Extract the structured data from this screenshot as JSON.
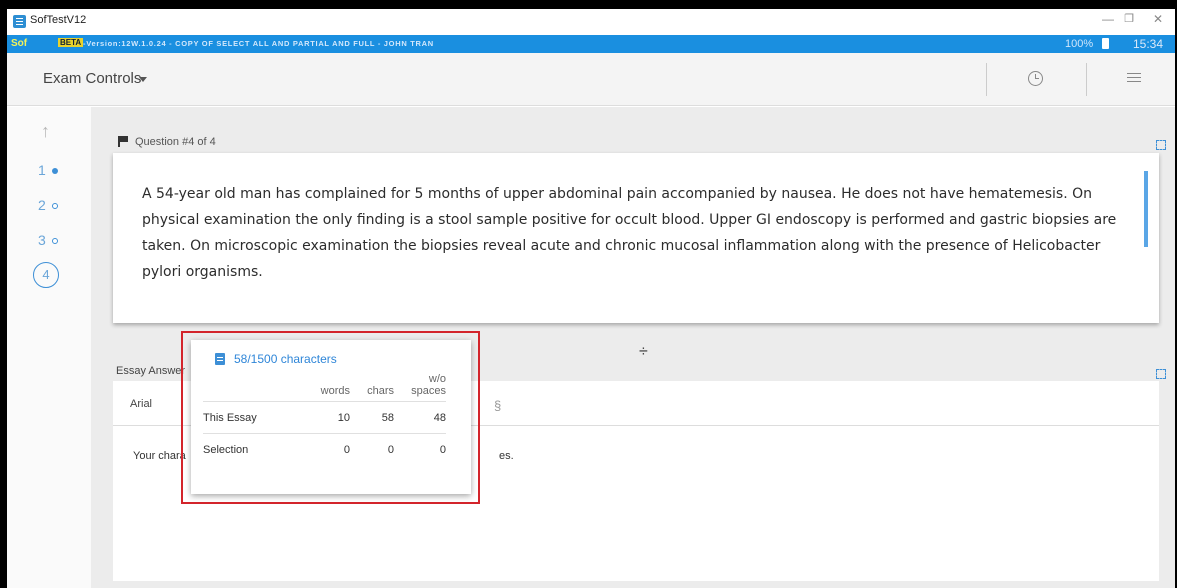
{
  "window": {
    "title": "SofTestV12",
    "minimize": "—",
    "maximize": "❐",
    "close": "✕"
  },
  "banner": {
    "brand": "Sof",
    "beta": "BETA",
    "version": "-Version:12W.1.0.24 - COPY OF SELECT ALL AND PARTIAL AND FULL - JOHN TRAN",
    "battery": "100%",
    "time": "15:34",
    "colors": {
      "banner": "#1a8fe0",
      "beta_badge": "#e8d22c"
    }
  },
  "toolbar": {
    "exam_controls": "Exam Controls",
    "icons": [
      "clock-icon",
      "menu-icon"
    ]
  },
  "nav": {
    "up_arrow": "↑",
    "questions": [
      {
        "label": "1",
        "status": "answered"
      },
      {
        "label": "2",
        "status": "unanswered"
      },
      {
        "label": "3",
        "status": "unanswered"
      }
    ],
    "current": "4"
  },
  "question": {
    "header": "Question #4 of 4",
    "text": "A 54-year old man has complained for 5 months of upper abdominal pain accompanied by nausea. He does not have hematemesis. On physical examination the only finding is a stool sample positive for occult blood. Upper GI endoscopy is performed and gastric biopsies are taken. On microscopic examination the biopsies reveal acute and chronic mucosal inflammation along with the presence of Helicobacter pylori organisms."
  },
  "essay": {
    "header": "Essay Answer",
    "font": "Arial",
    "section_symbol": "§",
    "text_start": "Your chara",
    "text_end": "es."
  },
  "popover": {
    "title": "58/1500 characters",
    "headers": {
      "words": "words",
      "chars": "chars",
      "spaces_1": "w/o",
      "spaces_2": "spaces"
    },
    "rows": [
      {
        "label": "This Essay",
        "words": "10",
        "chars": "58",
        "spaces": "48"
      },
      {
        "label": "Selection",
        "words": "0",
        "chars": "0",
        "spaces": "0"
      }
    ]
  },
  "accent_color": "#3d8fd6",
  "highlight_color": "#d3242b"
}
